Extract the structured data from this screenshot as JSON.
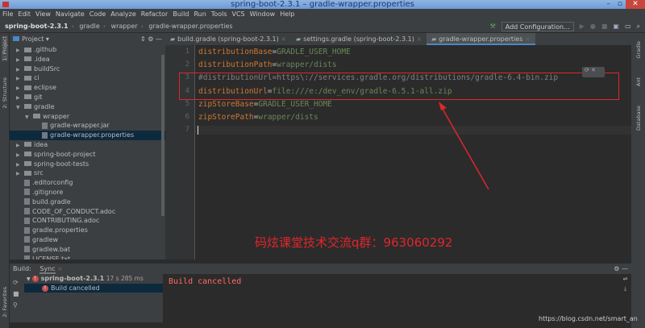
{
  "window": {
    "title": "spring-boot-2.3.1 – gradle-wrapper.properties",
    "minimize": "–",
    "maximize": "▫",
    "close": "✕"
  },
  "menu": [
    "File",
    "Edit",
    "View",
    "Navigate",
    "Code",
    "Analyze",
    "Refactor",
    "Build",
    "Run",
    "Tools",
    "VCS",
    "Window",
    "Help"
  ],
  "breadcrumb": [
    "spring-boot-2.3.1",
    "gradle",
    "wrapper",
    "gradle-wrapper.properties"
  ],
  "toolbar": {
    "add_configuration": "Add Configuration..."
  },
  "left_strip": {
    "project": "1: Project",
    "structure": "2: Structure",
    "favorites": "2: Favorites"
  },
  "right_strip": {
    "gradle": "Gradle",
    "ant": "Ant",
    "database": "Database"
  },
  "project_panel": {
    "title": "Project"
  },
  "tabs": [
    {
      "label": "build.gradle (spring-boot-2.3.1)"
    },
    {
      "label": "settings.gradle (spring-boot-2.3.1)"
    },
    {
      "label": "gradle-wrapper.properties"
    }
  ],
  "tree": [
    {
      "label": ".github",
      "type": "folder",
      "depth": 0,
      "arrow": "▶"
    },
    {
      "label": ".idea",
      "type": "folder",
      "depth": 0,
      "arrow": "▶"
    },
    {
      "label": "buildSrc",
      "type": "folder",
      "depth": 0,
      "arrow": "▶"
    },
    {
      "label": "ci",
      "type": "folder",
      "depth": 0,
      "arrow": "▶"
    },
    {
      "label": "eclipse",
      "type": "folder",
      "depth": 0,
      "arrow": "▶"
    },
    {
      "label": "git",
      "type": "folder",
      "depth": 0,
      "arrow": "▶"
    },
    {
      "label": "gradle",
      "type": "folder",
      "depth": 0,
      "arrow": "▼"
    },
    {
      "label": "wrapper",
      "type": "folder",
      "depth": 1,
      "arrow": "▼"
    },
    {
      "label": "gradle-wrapper.jar",
      "type": "file",
      "depth": 2,
      "arrow": ""
    },
    {
      "label": "gradle-wrapper.properties",
      "type": "file",
      "depth": 2,
      "arrow": "",
      "selected": true
    },
    {
      "label": "idea",
      "type": "folder",
      "depth": 0,
      "arrow": "▶"
    },
    {
      "label": "spring-boot-project",
      "type": "folder",
      "depth": 0,
      "arrow": "▶"
    },
    {
      "label": "spring-boot-tests",
      "type": "folder",
      "depth": 0,
      "arrow": "▶"
    },
    {
      "label": "src",
      "type": "folder",
      "depth": 0,
      "arrow": "▶"
    },
    {
      "label": ".editorconfig",
      "type": "file",
      "depth": 0,
      "arrow": ""
    },
    {
      "label": ".gitignore",
      "type": "file",
      "depth": 0,
      "arrow": ""
    },
    {
      "label": "build.gradle",
      "type": "file",
      "depth": 0,
      "arrow": ""
    },
    {
      "label": "CODE_OF_CONDUCT.adoc",
      "type": "file",
      "depth": 0,
      "arrow": ""
    },
    {
      "label": "CONTRIBUTING.adoc",
      "type": "file",
      "depth": 0,
      "arrow": ""
    },
    {
      "label": "gradle.properties",
      "type": "file",
      "depth": 0,
      "arrow": ""
    },
    {
      "label": "gradlew",
      "type": "file",
      "depth": 0,
      "arrow": ""
    },
    {
      "label": "gradlew.bat",
      "type": "file",
      "depth": 0,
      "arrow": ""
    },
    {
      "label": "LICENSE.txt",
      "type": "file",
      "depth": 0,
      "arrow": ""
    }
  ],
  "editor": {
    "lines": [
      {
        "n": "1",
        "key": "distributionBase",
        "eq": "=",
        "val": "GRADLE_USER_HOME"
      },
      {
        "n": "2",
        "key": "distributionPath",
        "eq": "=",
        "val": "wrapper/dists"
      },
      {
        "n": "3",
        "comment": "#distributionUrl=https\\://services.gradle.org/distributions/gradle-6.4-bin.zip"
      },
      {
        "n": "4",
        "key": "distributionUrl",
        "eq": "=",
        "val": "file:///e:/dev_env/gradle-6.5.1-all.zip"
      },
      {
        "n": "5",
        "key": "zipStoreBase",
        "eq": "=",
        "val": "GRADLE_USER_HOME"
      },
      {
        "n": "6",
        "key": "zipStorePath",
        "eq": "=",
        "val": "wrapper/dists"
      },
      {
        "n": "7"
      }
    ]
  },
  "annotation": {
    "text": "码炫课堂技术交流q群：963060292",
    "color": "#e0262b"
  },
  "build": {
    "tab_build": "Build:",
    "tab_sync": "Sync",
    "root": "spring-boot-2.3.1",
    "time": "17 s 285 ms",
    "child": "Build cancelled",
    "output": "Build cancelled"
  },
  "watermark": "https://blog.csdn.net/smart_an"
}
